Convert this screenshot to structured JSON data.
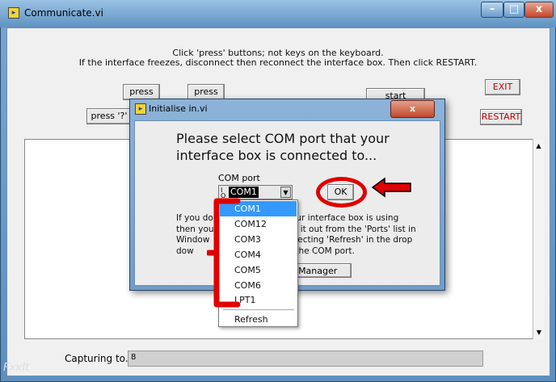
{
  "window": {
    "title": "Communicate.vi"
  },
  "instructions": {
    "line1": "Click 'press' buttons; not keys on the keyboard.",
    "line2": "If the interface freezes, disconnect then reconnect the interface box. Then click RESTART."
  },
  "buttons": {
    "press_y": "press 'y'",
    "press_n": "press 'n'",
    "press_q": "press '?'",
    "start_capture": "start capture",
    "exit": "EXIT",
    "restart": "RESTART"
  },
  "capture": {
    "label": "Capturing to...",
    "path_icon": "8"
  },
  "dialog": {
    "title": "Initialise in.vi",
    "prompt": "Please select COM port that your interface box is connected to...",
    "com_label": "COM port",
    "com_selected": "COM1",
    "ok": "OK",
    "info_parts": [
      "If you do",
      "port your interface box is using",
      "then you",
      "ork it out from the 'Ports' list in",
      "Window",
      "selecting 'Refresh' in the drop",
      "dow",
      "see the COM port."
    ],
    "device_manager": "ice Manager"
  },
  "dropdown": {
    "items": [
      "COM1",
      "COM12",
      "COM3",
      "COM4",
      "COM5",
      "COM6",
      "LPT1"
    ],
    "refresh": "Refresh",
    "selected_index": 0
  },
  "watermark": "Fxxft",
  "colors": {
    "annotation": "#e00000",
    "selection": "#3399ff",
    "exit_text": "#c40000"
  }
}
